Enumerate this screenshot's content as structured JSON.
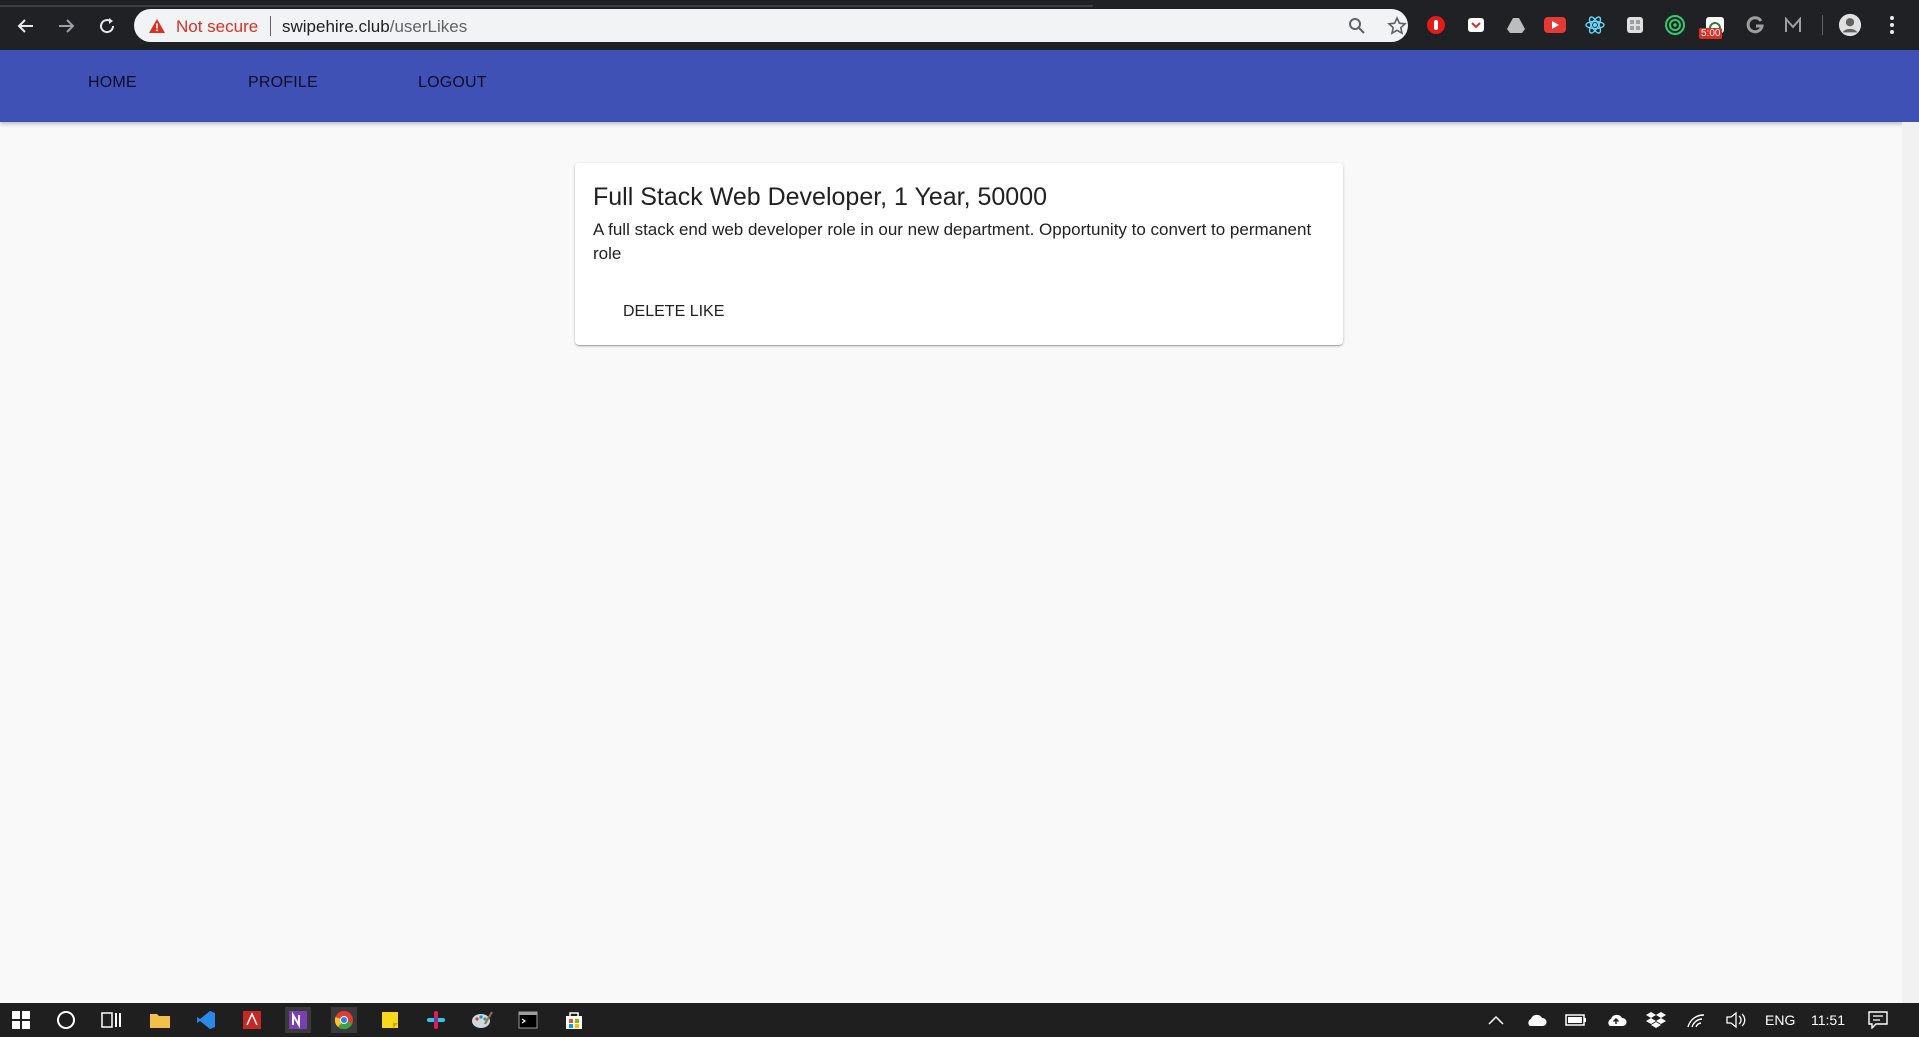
{
  "browser": {
    "security_label": "Not secure",
    "url_host": "swipehire.club",
    "url_path": "/userLikes",
    "extension_badge": "5:00"
  },
  "appbar": {
    "links": [
      {
        "label": "HOME"
      },
      {
        "label": "PROFILE"
      },
      {
        "label": "LOGOUT"
      }
    ],
    "color": "#3f51b5"
  },
  "like_card": {
    "title": "Full Stack Web Developer, 1 Year, 50000",
    "description": "A full stack end web developer role in our new department. Opportunity to convert to permanent role",
    "action_label": "DELETE LIKE"
  },
  "taskbar": {
    "language": "ENG",
    "time": "11:51"
  }
}
